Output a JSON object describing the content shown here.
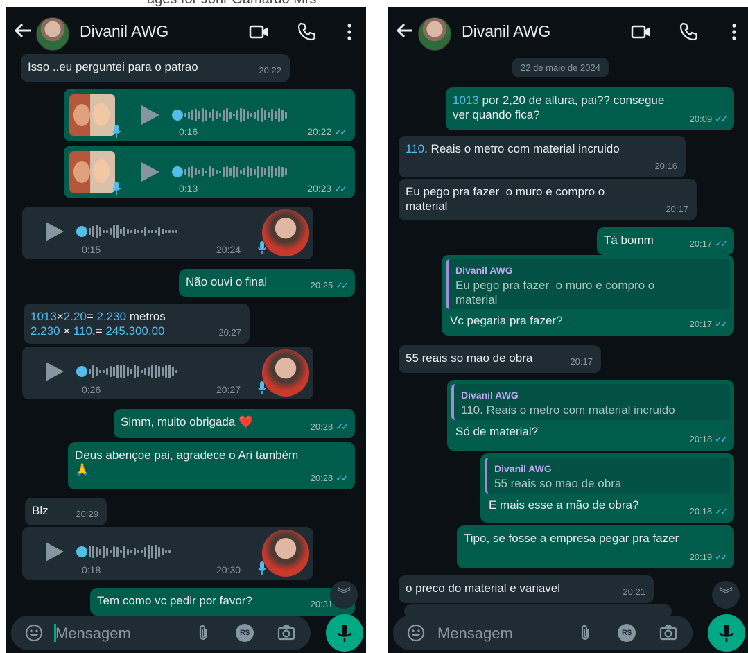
{
  "caption": "ages for Johr Gamardo Mrs",
  "contact": {
    "name": "Divanil AWG"
  },
  "left": {
    "messages": [
      {
        "dir": "in",
        "text": "Isso ..eu perguntei para o patrao",
        "time": "20:22"
      },
      {
        "dir": "out",
        "kind": "audio",
        "duration": "0:16",
        "time": "20:22"
      },
      {
        "dir": "out",
        "kind": "audio",
        "duration": "0:13",
        "time": "20:23"
      },
      {
        "dir": "in",
        "kind": "audio",
        "duration": "0:15",
        "time": "20:24"
      },
      {
        "dir": "out",
        "text": "Não ouvi o final",
        "time": "20:25"
      },
      {
        "dir": "in",
        "line1_a": "1013",
        "line1_b": "×",
        "line1_c": "2.20",
        "line1_d": "= ",
        "line1_e": "2.230",
        "line1_f": " metros",
        "line2_a": "2.230",
        "line2_b": " × ",
        "line2_c": "110",
        "line2_d": ".= ",
        "line2_e": "245.300.00",
        "time": "20:27"
      },
      {
        "dir": "in",
        "kind": "audio",
        "duration": "0:26",
        "time": "20:27"
      },
      {
        "dir": "out",
        "text": "Simm, muito obrigada ❤️",
        "time": "20:28"
      },
      {
        "dir": "out",
        "text": "Deus abençoe pai, agradece o Ari também\n🙏",
        "time": "20:28"
      },
      {
        "dir": "in",
        "text": "Blz",
        "time": "20:29"
      },
      {
        "dir": "in",
        "kind": "audio",
        "duration": "0:18",
        "time": "20:30"
      },
      {
        "dir": "out",
        "text": "Tem como vc pedir por favor?",
        "time": "20:31"
      }
    ]
  },
  "right": {
    "date_chip": "22 de maio de 2024",
    "messages": [
      {
        "dir": "out",
        "num": "1013",
        "text": " por 2,20 de altura, pai?? consegue\nver quando fica?",
        "time": "20:09"
      },
      {
        "dir": "in",
        "num": "110",
        "text": ". Reais o metro com material incruido",
        "time": "20:16"
      },
      {
        "dir": "in",
        "text": "Eu pego pra fazer  o muro e compro o\nmaterial",
        "time": "20:17"
      },
      {
        "dir": "out",
        "text": "Tá bomm",
        "time": "20:17"
      },
      {
        "dir": "out",
        "quote_author": "Divanil AWG",
        "quote_text": "Eu pego pra fazer  o muro e compro o\nmaterial",
        "text": "Vc pegaria pra fazer?",
        "time": "20:17"
      },
      {
        "dir": "in",
        "text": "55 reais so mao de obra",
        "time": "20:17"
      },
      {
        "dir": "out",
        "quote_author": "Divanil AWG",
        "quote_text": "110. Reais o metro com material incruido",
        "text": "Só de material?",
        "time": "20:18"
      },
      {
        "dir": "out",
        "quote_author": "Divanil AWG",
        "quote_text": "55 reais so mao de obra",
        "text": "E mais esse a mão de obra?",
        "time": "20:18"
      },
      {
        "dir": "out",
        "text": "Tipo, se fosse a empresa pegar pra fazer",
        "time": "20:19"
      },
      {
        "dir": "in",
        "text": "o preco do material e variavel",
        "time": "20:21"
      }
    ]
  },
  "composer": {
    "placeholder": "Mensagem",
    "rs_label": "R$"
  },
  "icons": {
    "back": "arrow-left-icon",
    "video": "video-camera-icon",
    "call": "phone-icon",
    "menu": "more-vertical-icon",
    "emoji": "emoji-icon",
    "attach": "paperclip-icon",
    "payment": "payment-icon",
    "camera": "camera-icon",
    "mic": "microphone-icon",
    "scroll": "chevrons-down-icon"
  },
  "colors": {
    "background": "#0b1014",
    "incoming": "#1f2c34",
    "outgoing": "#005c4b",
    "accent": "#00a884",
    "read_ticks": "#53bdeb"
  }
}
